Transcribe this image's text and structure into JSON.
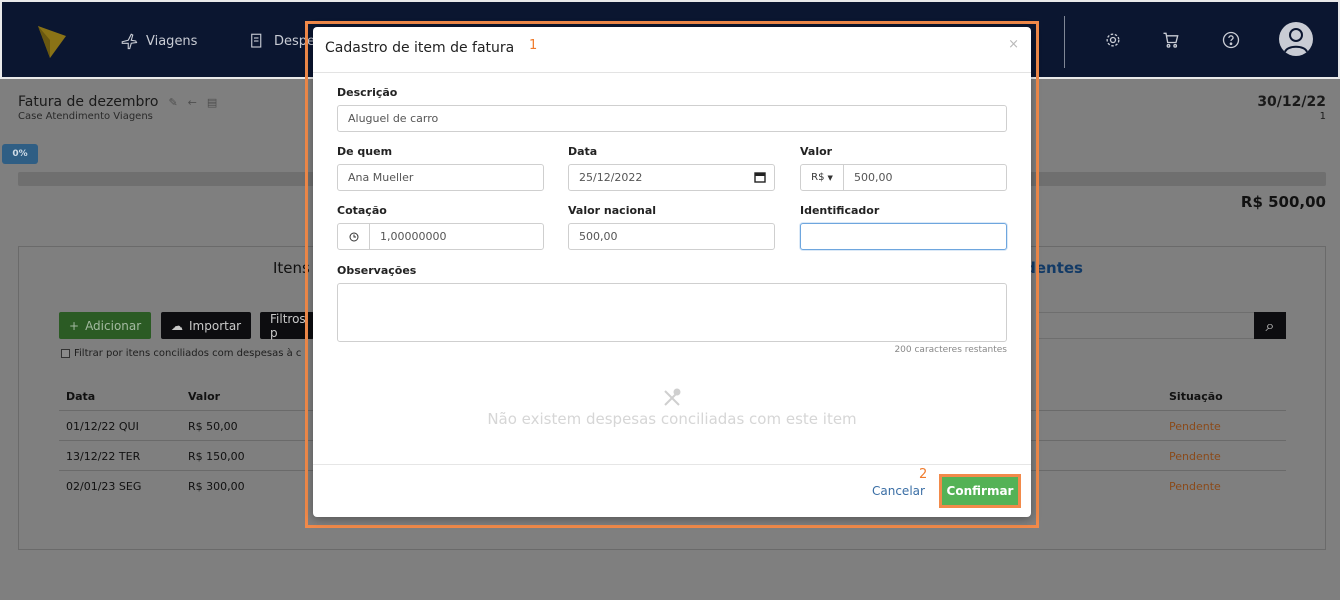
{
  "topbar": {
    "nav": [
      {
        "label": "Viagens",
        "icon": "plane-icon"
      },
      {
        "label": "Despe",
        "icon": "receipt-icon"
      }
    ],
    "icons": [
      "gear-icon",
      "cart-icon",
      "help-icon",
      "avatar-icon"
    ]
  },
  "invoice": {
    "title": "Fatura de dezembro",
    "subtitle": "Case Atendimento Viagens",
    "date": "30/12/22",
    "number": "1",
    "progress": "0%",
    "progress_value": 0,
    "total": "R$ 500,00"
  },
  "tabs": {
    "itens": "Itens",
    "pendentes": "dentes"
  },
  "toolbar": {
    "add": "Adicionar",
    "import": "Importar",
    "filters": "Filtros p",
    "filter_check": "Filtrar por itens conciliados com despesas à c"
  },
  "table": {
    "headers": {
      "data": "Data",
      "valor": "Valor",
      "situacao": "Situação"
    },
    "rows": [
      {
        "data": "01/12/22 QUI",
        "valor": "R$ 50,00",
        "situacao": "Pendente"
      },
      {
        "data": "13/12/22 TER",
        "valor": "R$ 150,00",
        "situacao": "Pendente"
      },
      {
        "data": "02/01/23 SEG",
        "valor": "R$ 300,00",
        "situacao": "Pendente"
      }
    ]
  },
  "modal": {
    "title": "Cadastro de item de fatura",
    "annotation_1": "1",
    "annotation_2": "2",
    "close": "×",
    "descricao_label": "Descrição",
    "descricao_value": "Aluguel de carro",
    "dequem_label": "De quem",
    "dequem_value": "Ana Mueller",
    "data_label": "Data",
    "data_value": "25/12/2022",
    "valor_label": "Valor",
    "currency": "R$",
    "valor_value": "500,00",
    "cotacao_label": "Cotação",
    "cotacao_value": "1,00000000",
    "valor_nacional_label": "Valor nacional",
    "valor_nacional_value": "500,00",
    "identificador_label": "Identificador",
    "identificador_value": "",
    "observacoes_label": "Observações",
    "chars_remaining": "200 caracteres restantes",
    "empty_text": "Não existem despesas conciliadas com este item",
    "cancel": "Cancelar",
    "confirm": "Confirmar"
  },
  "colors": {
    "accent": "#f28a4a",
    "confirm": "#54b256",
    "navy": "#0b1630"
  }
}
